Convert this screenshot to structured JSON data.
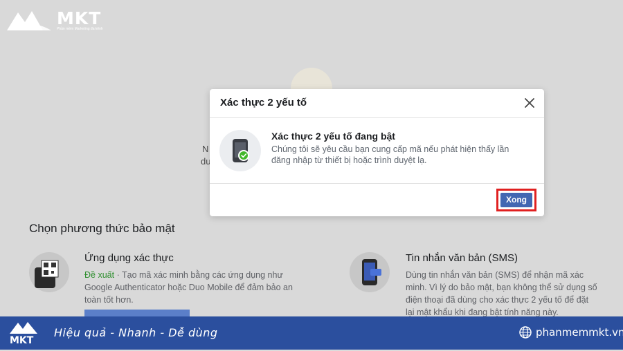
{
  "branding": {
    "name": "MKT",
    "tagline": "Phần mềm Marketing đa kênh",
    "footer_slogan": "Hiệu quả - Nhanh  - Dễ dùng",
    "website": "phanmemmkt.vn"
  },
  "background": {
    "fragment_1": "N",
    "fragment_2": "du",
    "section_title": "Chọn phương thức bảo mật",
    "methods": [
      {
        "title": "Ứng dụng xác thực",
        "recommended": "Đề xuất",
        "desc": " · Tạo mã xác minh bằng các ứng dụng như Google Authenticator hoặc Duo Mobile để đảm bảo an toàn tốt hơn."
      },
      {
        "title": "Tin nhắn văn bản (SMS)",
        "desc": "Dùng tin nhắn văn bản (SMS) để nhận mã xác minh. Vì lý do bảo mật, bạn không thể sử dụng số điện thoại đã dùng cho xác thực 2 yếu tố để đặt lại mật khẩu khi đang bật tính năng này."
      }
    ]
  },
  "modal": {
    "title": "Xác thực 2 yếu tố",
    "body_title": "Xác thực 2 yếu tố đang bật",
    "body_desc": "Chúng tôi sẽ yêu cầu bạn cung cấp mã nếu phát hiện thấy lần đăng nhập từ thiết bị hoặc trình duyệt lạ.",
    "done_label": "Xong"
  },
  "colors": {
    "primary": "#4267b2",
    "highlight": "#e02020",
    "banner": "#2b4f9e"
  }
}
